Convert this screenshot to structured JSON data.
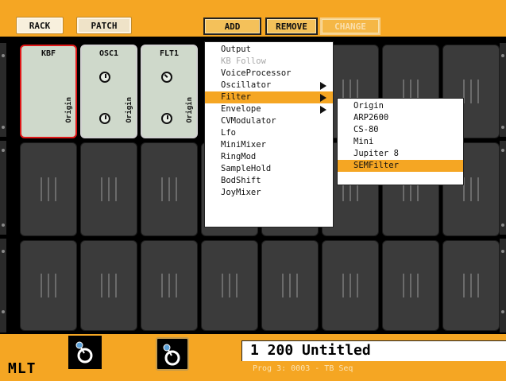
{
  "tabs": {
    "rack": "RACK",
    "patch": "PATCH"
  },
  "toolbar": {
    "add": "ADD",
    "remove": "REMOVE",
    "change": "CHANGE"
  },
  "modules": [
    {
      "title": "KBF",
      "side": "Origin"
    },
    {
      "title": "OSC1",
      "side": "Origin"
    },
    {
      "title": "FLT1",
      "side": "Origin"
    }
  ],
  "menu": {
    "items": [
      "Output",
      "KB Follow",
      "VoiceProcessor",
      "Oscillator",
      "Filter",
      "Envelope",
      "CVModulator",
      "Lfo",
      "MiniMixer",
      "RingMod",
      "SampleHold",
      "BodShift",
      "JoyMixer"
    ],
    "disabled": "KB Follow",
    "highlighted": "Filter"
  },
  "submenu": {
    "items": [
      "Origin",
      "ARP2600",
      "CS-80",
      "Mini",
      "Jupiter 8",
      "SEMFilter"
    ],
    "highlighted": "SEMFilter"
  },
  "footer": {
    "brand": "MLT",
    "patch_title": "1 200 Untitled",
    "prog_line": "Prog 3: 0003 - TB Seq"
  },
  "icons": {
    "screw": "screw-icon",
    "knob": "knob-icon",
    "arrow": "submenu-arrow-icon",
    "controller": "joystick-icon"
  },
  "colors": {
    "accent": "#f5a623",
    "module": "#cfd9cb",
    "selected": "#e01818",
    "slot": "#3b3b3b"
  }
}
